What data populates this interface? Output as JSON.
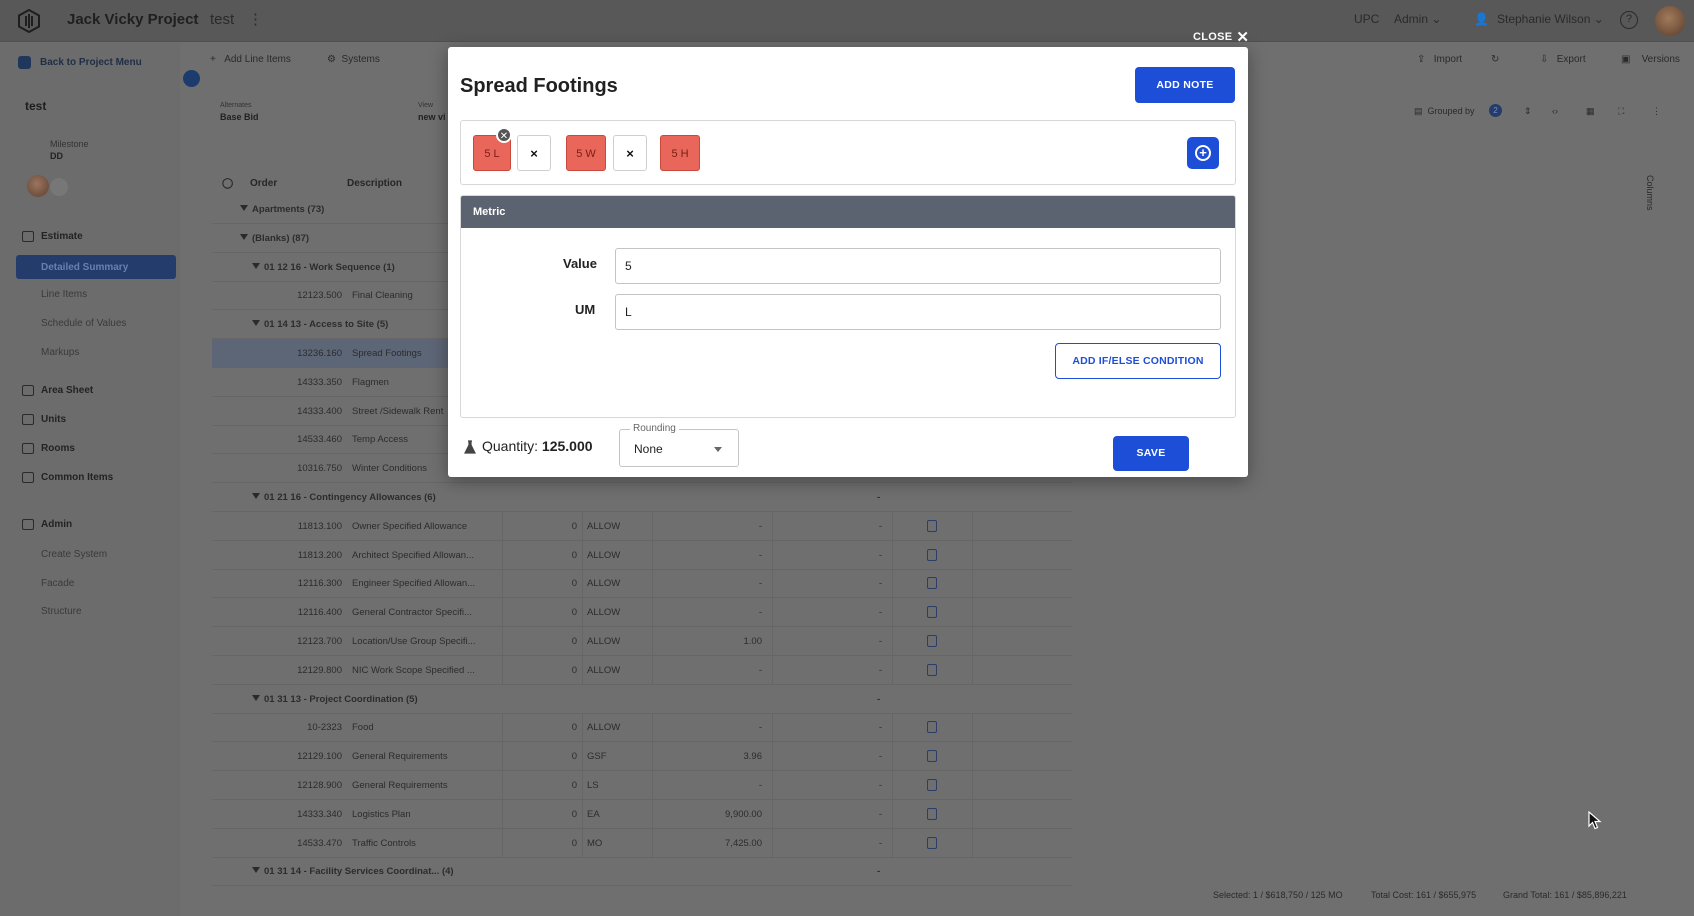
{
  "topbar": {
    "project": "Jack Vicky Project",
    "breadcrumb": "test",
    "company": "UPC",
    "role": "Admin",
    "user": "Stephanie Wilson"
  },
  "sidebar": {
    "back": "Back to Project Menu",
    "title": "test",
    "milestone_label": "Milestone",
    "milestone_value": "DD",
    "estimate": "Estimate",
    "estimate_items": [
      "Detailed Summary",
      "Line Items",
      "Schedule of Values",
      "Markups"
    ],
    "area_sheet": "Area Sheet",
    "units": "Units",
    "rooms": "Rooms",
    "common_items": "Common Items",
    "admin": "Admin",
    "admin_items": [
      "Create System",
      "Facade",
      "Structure"
    ]
  },
  "toolbar": {
    "add_line_items": "Add Line Items",
    "systems": "Systems",
    "import": "Import",
    "export": "Export",
    "versions": "Versions",
    "grouped_by": "Grouped by",
    "grouped_count": "2",
    "columns": "Columns"
  },
  "filters": {
    "alternates_label": "Alternates",
    "alternates_value": "Base Bid",
    "view_label": "View",
    "view_value": "new vi"
  },
  "grid": {
    "headers": {
      "order": "Order",
      "description": "Description"
    },
    "rows": [
      {
        "type": "group",
        "order": "Apartments (73)",
        "desc": ""
      },
      {
        "type": "group",
        "order": "(Blanks) (87)",
        "desc": ""
      },
      {
        "type": "group",
        "order": "01 12 16 - Work Sequence (1)",
        "desc": ""
      },
      {
        "type": "item",
        "order": "12123.500",
        "desc": "Final Cleaning"
      },
      {
        "type": "group",
        "order": "01 14 13 - Access to Site (5)",
        "desc": ""
      },
      {
        "type": "item",
        "order": "13236.160",
        "desc": "Spread Footings",
        "hl": true
      },
      {
        "type": "item",
        "order": "14333.350",
        "desc": "Flagmen"
      },
      {
        "type": "item",
        "order": "14333.400",
        "desc": "Street /Sidewalk Rent"
      },
      {
        "type": "item",
        "order": "14533.460",
        "desc": "Temp Access"
      },
      {
        "type": "item",
        "order": "10316.750",
        "desc": "Winter Conditions"
      },
      {
        "type": "group",
        "order": "01 21 16 - Contingency Allowances (6)",
        "desc": "",
        "dash": "-"
      },
      {
        "type": "item",
        "order": "11813.100",
        "desc": "Owner Specified Allowance",
        "qty": "0",
        "um": "ALLOW",
        "rate": "-",
        "total": "-"
      },
      {
        "type": "item",
        "order": "11813.200",
        "desc": "Architect Specified Allowan...",
        "qty": "0",
        "um": "ALLOW",
        "rate": "-",
        "total": "-"
      },
      {
        "type": "item",
        "order": "12116.300",
        "desc": "Engineer Specified Allowan...",
        "qty": "0",
        "um": "ALLOW",
        "rate": "-",
        "total": "-"
      },
      {
        "type": "item",
        "order": "12116.400",
        "desc": "General Contractor Specifi...",
        "qty": "0",
        "um": "ALLOW",
        "rate": "-",
        "total": "-"
      },
      {
        "type": "item",
        "order": "12123.700",
        "desc": "Location/Use Group Specifi...",
        "qty": "0",
        "um": "ALLOW",
        "rate": "1.00",
        "total": "-"
      },
      {
        "type": "item",
        "order": "12129.800",
        "desc": "NIC Work Scope Specified ...",
        "qty": "0",
        "um": "ALLOW",
        "rate": "-",
        "total": "-"
      },
      {
        "type": "group",
        "order": "01 31 13 - Project Coordination (5)",
        "desc": "",
        "dash": "-"
      },
      {
        "type": "item",
        "order": "10-2323",
        "desc": "Food",
        "qty": "0",
        "um": "ALLOW",
        "rate": "-",
        "total": "-"
      },
      {
        "type": "item",
        "order": "12129.100",
        "desc": "General Requirements",
        "qty": "0",
        "um": "GSF",
        "rate": "3.96",
        "total": "-"
      },
      {
        "type": "item",
        "order": "12128.900",
        "desc": "General Requirements",
        "qty": "0",
        "um": "LS",
        "rate": "-",
        "total": "-"
      },
      {
        "type": "item",
        "order": "14333.340",
        "desc": "Logistics Plan",
        "qty": "0",
        "um": "EA",
        "rate": "9,900.00",
        "total": "-"
      },
      {
        "type": "item",
        "order": "14533.470",
        "desc": "Traffic Controls",
        "qty": "0",
        "um": "MO",
        "rate": "7,425.00",
        "total": "-"
      },
      {
        "type": "group",
        "order": "01 31 14 - Facility Services Coordinat...  (4)",
        "desc": "",
        "dash": "-"
      }
    ]
  },
  "footer": {
    "selected": "Selected: 1 / $618,750 / 125 MO",
    "total_cost": "Total Cost: 161 / $655,975",
    "grand_total": "Grand Total: 161 / $85,896,221"
  },
  "modal": {
    "close": "CLOSE",
    "title": "Spread Footings",
    "add_note": "ADD NOTE",
    "tokens": [
      "5 L",
      "×",
      "5 W",
      "×",
      "5 H"
    ],
    "metric_header": "Metric",
    "value_label": "Value",
    "value": "5",
    "um_label": "UM",
    "um": "L",
    "add_condition": "ADD IF/ELSE CONDITION",
    "quantity_label": "Quantity:",
    "quantity_value": "125.000",
    "rounding_label": "Rounding",
    "rounding_value": "None",
    "save": "SAVE"
  },
  "colors": {
    "primary": "#1d4ed8",
    "token_red": "#e8675a",
    "overlay": "#6f6f6f"
  }
}
